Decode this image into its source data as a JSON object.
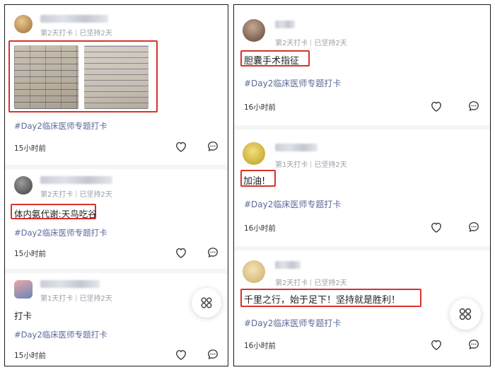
{
  "left_panel": {
    "posts": [
      {
        "meta": {
          "day": "第2天打卡",
          "streak": "已坚持2天"
        },
        "content": "",
        "tag": "#Day2临床医师专题打卡",
        "time": "15小时前",
        "images": [
          "handwritten-notes-photo",
          "handwritten-notes-photo"
        ]
      },
      {
        "meta": {
          "day": "第2天打卡",
          "streak": "已坚持2天"
        },
        "content": "体内氨代谢:天鸟吃谷",
        "tag": "#Day2临床医师专题打卡",
        "time": "15小时前"
      },
      {
        "meta": {
          "day": "第1天打卡",
          "streak": "已坚持2天"
        },
        "content": "打卡",
        "tag": "#Day2临床医师专题打卡",
        "time": "15小时前"
      }
    ]
  },
  "right_panel": {
    "posts": [
      {
        "meta": {
          "day": "第2天打卡",
          "streak": "已坚持2天"
        },
        "content": "胆囊手术指征",
        "tag": "#Day2临床医师专题打卡",
        "time": "16小时前"
      },
      {
        "meta": {
          "day": "第1天打卡",
          "streak": "已坚持2天"
        },
        "content": "加油!",
        "tag": "#Day2临床医师专题打卡",
        "time": "16小时前"
      },
      {
        "meta": {
          "day": "第2天打卡",
          "streak": "已坚持2天"
        },
        "content": "千里之行，始于足下！坚持就是胜利！",
        "tag": "#Day2临床医师专题打卡",
        "time": "16小时前"
      }
    ]
  },
  "icons": {
    "like": "heart-outline-icon",
    "comment": "comment-bubble-icon",
    "fab": "four-petal-menu-icon"
  },
  "colors": {
    "highlight_box": "#d9322c",
    "tag_text": "#5b6a98",
    "meta_text": "#9a9ea8"
  }
}
